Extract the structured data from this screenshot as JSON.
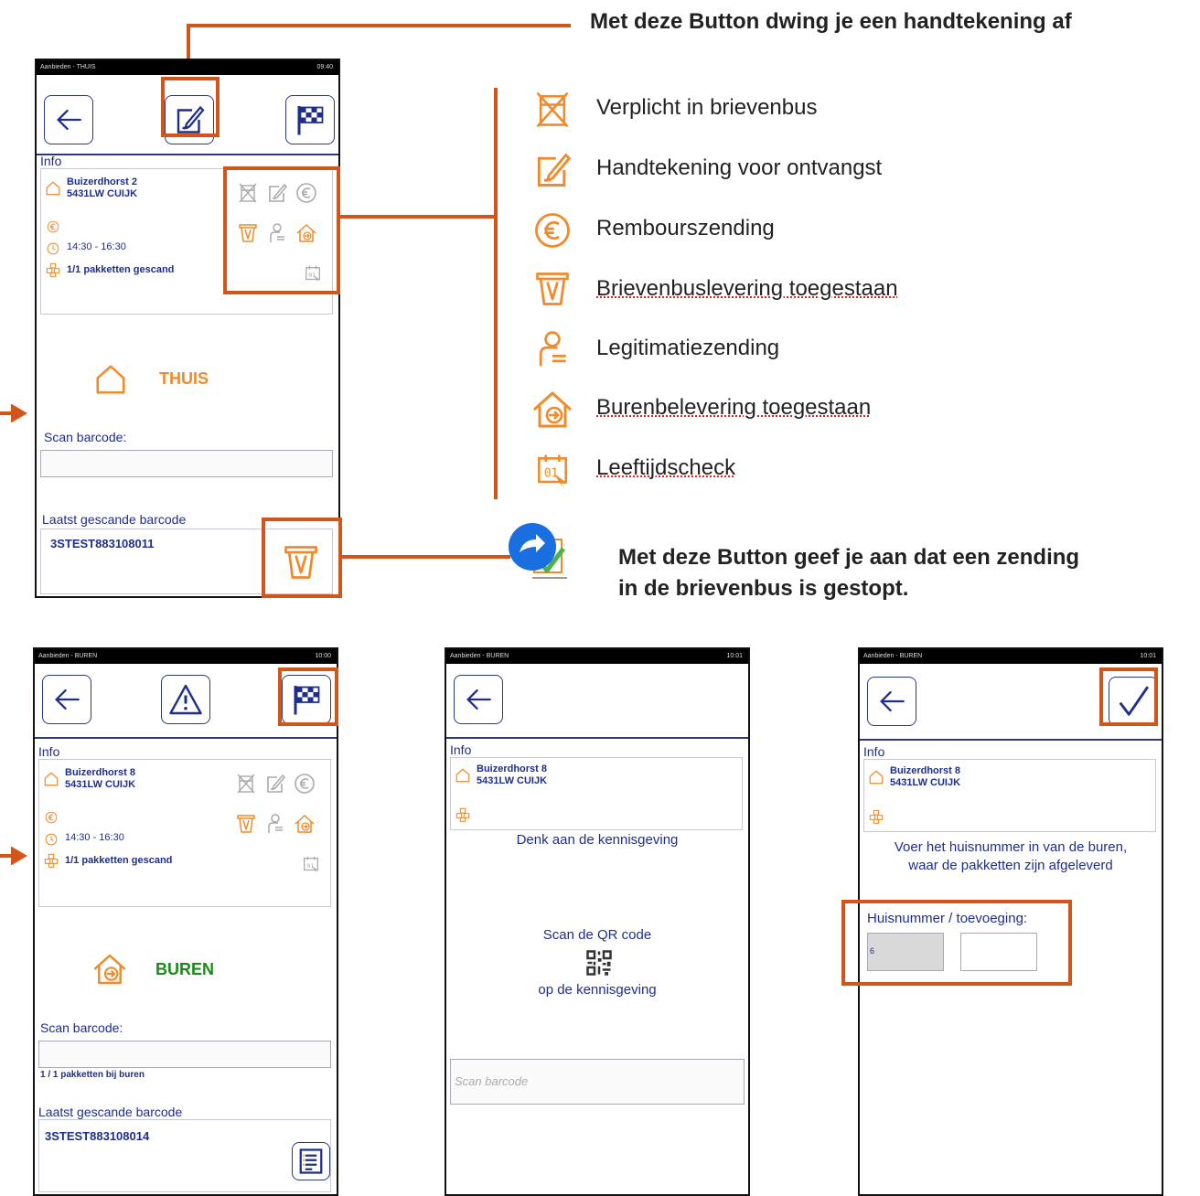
{
  "annotations": {
    "signature_caption": "Met deze Button dwing je een handtekening af",
    "mailbox_caption_line1": "Met deze Button geef je aan dat een zending",
    "mailbox_caption_line2": "in de brievenbus is gestopt."
  },
  "legend": [
    {
      "icon": "no-mailbox-icon",
      "label": "Verplicht in brievenbus"
    },
    {
      "icon": "signature-icon",
      "label": "Handtekening voor ontvangst"
    },
    {
      "icon": "euro-icon",
      "label": "Rembourszending"
    },
    {
      "icon": "mailbox-icon",
      "label": "Brievenbuslevering toegestaan"
    },
    {
      "icon": "person-id-icon",
      "label": "Legitimatiezending"
    },
    {
      "icon": "neighbor-house-icon",
      "label": "Burenbelevering toegestaan"
    },
    {
      "icon": "age-check-icon",
      "label": "Leeftijdscheck"
    }
  ],
  "colors": {
    "accent": "#d2561c",
    "icon_orange": "#f08a2a",
    "text_blue": "#1e2e8c",
    "green": "#1a8a1a"
  },
  "screen1": {
    "status_title": "Aanbieden - THUIS",
    "status_time": "09:40",
    "info_label": "Info",
    "address_line1": "Buizerdhorst 2",
    "address_line2": "5431LW CUIJK",
    "time_window": "14:30 - 16:30",
    "packages": "1/1 pakketten gescand",
    "mode": "THUIS",
    "scan_label": "Scan barcode:",
    "last_scanned_label": "Laatst gescande barcode",
    "last_barcode": "3STEST883108011"
  },
  "screen2": {
    "status_title": "Aanbieden - BUREN",
    "status_time": "10:00",
    "info_label": "Info",
    "address_line1": "Buizerdhorst 8",
    "address_line2": "5431LW CUIJK",
    "time_window": "14:30 - 16:30",
    "packages": "1/1 pakketten gescand",
    "mode": "BUREN",
    "scan_label": "Scan barcode:",
    "neighbours_count": "1 / 1 pakketten bij buren",
    "last_scanned_label": "Laatst gescande barcode",
    "last_barcode": "3STEST883108014"
  },
  "screen3": {
    "status_title": "Aanbieden - BUREN",
    "status_time": "10:01",
    "info_label": "Info",
    "address_line1": "Buizerdhorst 8",
    "address_line2": "5431LW CUIJK",
    "notice": "Denk aan de kennisgeving",
    "scan_qr_line1": "Scan de QR code",
    "scan_qr_line2": "op de kennisgeving",
    "scan_placeholder": "Scan barcode"
  },
  "screen4": {
    "status_title": "Aanbieden - BUREN",
    "status_time": "10:01",
    "info_label": "Info",
    "address_line1": "Buizerdhorst 8",
    "address_line2": "5431LW CUIJK",
    "instruction_line1": "Voer het huisnummer in van de buren,",
    "instruction_line2": "waar de pakketten zijn afgeleverd",
    "house_label": "Huisnummer / toevoeging:",
    "house_value": "6"
  }
}
